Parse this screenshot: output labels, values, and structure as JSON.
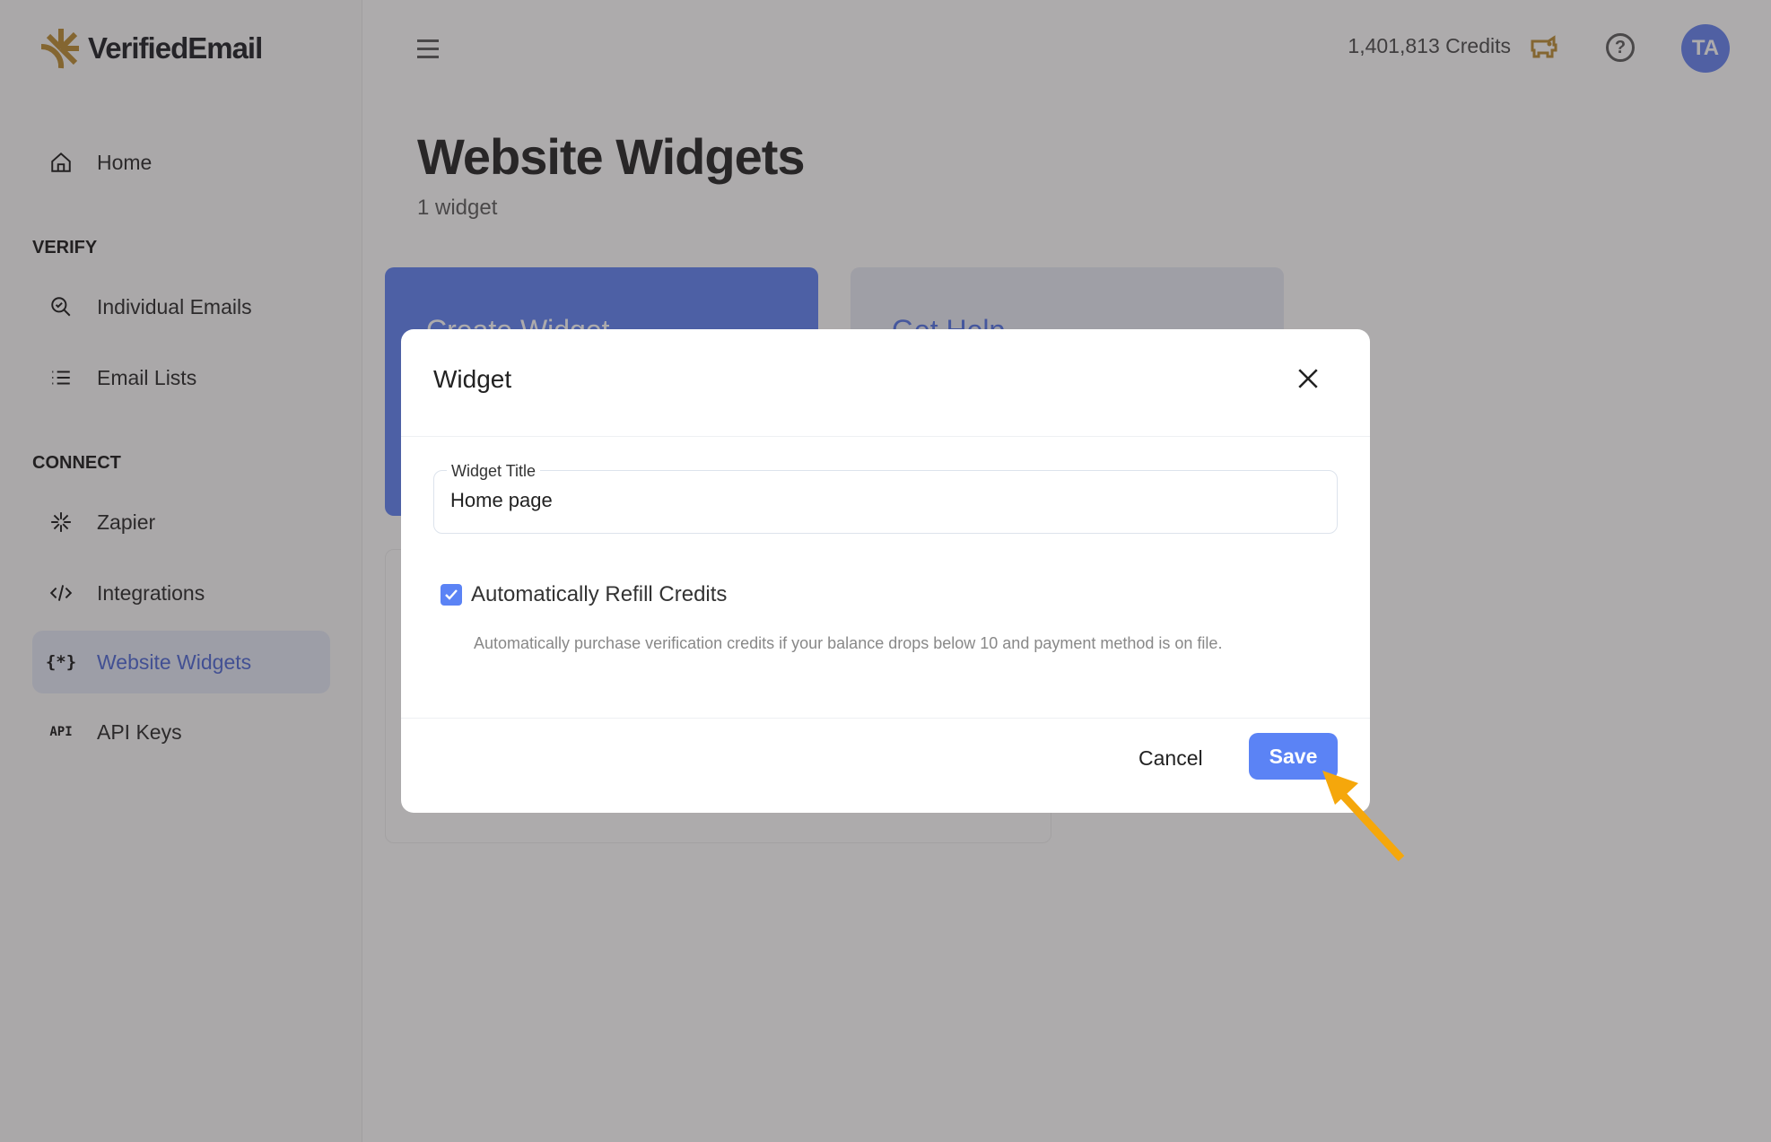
{
  "app": {
    "logo_text": "VerifiedEmail",
    "brand_color": "#b8892c",
    "accent_color": "#5b83f5"
  },
  "sidebar": {
    "home": {
      "label": "Home",
      "icon": "home-icon"
    },
    "sections": [
      {
        "title": "VERIFY",
        "items": [
          {
            "label": "Individual Emails",
            "icon": "search-check-icon"
          },
          {
            "label": "Email Lists",
            "icon": "list-icon"
          }
        ]
      },
      {
        "title": "CONNECT",
        "items": [
          {
            "label": "Zapier",
            "icon": "zapier-icon"
          },
          {
            "label": "Integrations",
            "icon": "code-icon"
          },
          {
            "label": "Website Widgets",
            "icon": "braces-asterisk-icon",
            "active": true
          },
          {
            "label": "API Keys",
            "icon": "api-icon"
          }
        ]
      }
    ]
  },
  "topbar": {
    "credits": "1,401,813 Credits",
    "help_icon": "?",
    "avatar_initials": "TA"
  },
  "page": {
    "title": "Website Widgets",
    "subtitle": "1 widget",
    "cards": {
      "create": "Create Widget",
      "help": "Get Help"
    }
  },
  "modal": {
    "title": "Widget",
    "field_label": "Widget Title",
    "field_value": "Home page",
    "checkbox_label": "Automatically Refill Credits",
    "checkbox_checked": true,
    "help_text": "Automatically purchase verification credits if your balance drops below 10 and payment method is on file.",
    "cancel_label": "Cancel",
    "save_label": "Save"
  }
}
